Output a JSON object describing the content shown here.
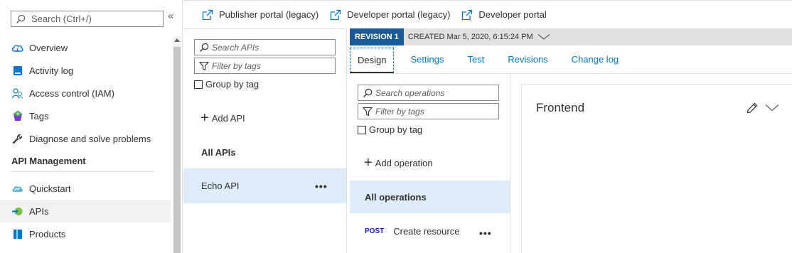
{
  "leftnav": {
    "search_placeholder": "Search (Ctrl+/)",
    "collapse_glyph": "«",
    "items": [
      {
        "label": "Overview",
        "icon": "cloud-icon"
      },
      {
        "label": "Activity log",
        "icon": "activity-log-icon"
      },
      {
        "label": "Access control (IAM)",
        "icon": "people-icon"
      },
      {
        "label": "Tags",
        "icon": "tag-icon"
      },
      {
        "label": "Diagnose and solve problems",
        "icon": "wrench-icon"
      }
    ],
    "section_title": "API Management",
    "section_items": [
      {
        "label": "Quickstart",
        "icon": "quickstart-cloud-icon"
      },
      {
        "label": "APIs",
        "icon": "api-icon",
        "selected": true
      },
      {
        "label": "Products",
        "icon": "products-icon"
      }
    ]
  },
  "topbar": {
    "links": [
      "Publisher portal (legacy)",
      "Developer portal (legacy)",
      "Developer portal"
    ]
  },
  "apis": {
    "search_placeholder": "Search APIs",
    "filter_placeholder": "Filter by tags",
    "group_by_tag": "Group by tag",
    "add_api": "Add API",
    "all_apis": "All APIs",
    "items": [
      {
        "label": "Echo API",
        "more": "•••"
      }
    ]
  },
  "revision": {
    "badge": "REVISION 1",
    "created": "CREATED Mar 5, 2020, 6:15:24 PM"
  },
  "tabs": [
    "Design",
    "Settings",
    "Test",
    "Revisions",
    "Change log"
  ],
  "operations": {
    "search_placeholder": "Search operations",
    "filter_placeholder": "Filter by tags",
    "group_by_tag": "Group by tag",
    "add_operation": "Add operation",
    "all_operations": "All operations",
    "items": [
      {
        "method": "POST",
        "label": "Create resource",
        "more": "•••"
      }
    ]
  },
  "frontend": {
    "title": "Frontend"
  },
  "colors": {
    "accent": "#0078d4",
    "revision_badge": "#1a5a96",
    "selected_row": "#deecf9",
    "post_method": "#1a1adc"
  }
}
